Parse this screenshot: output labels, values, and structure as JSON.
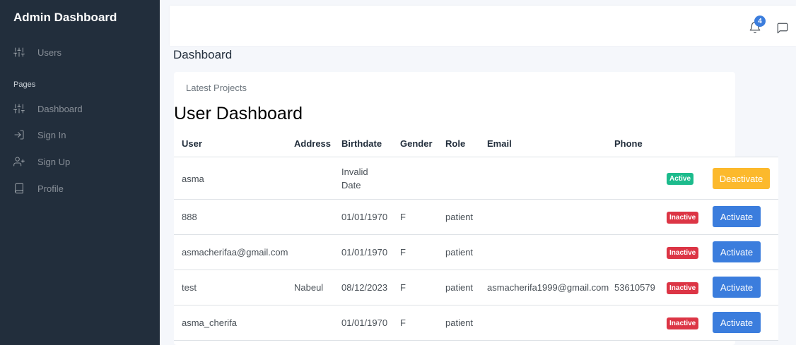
{
  "sidebar": {
    "brand": "Admin Dashboard",
    "items_top": [
      {
        "label": "Users",
        "icon": "sliders-icon"
      }
    ],
    "section_header": "Pages",
    "items": [
      {
        "label": "Dashboard",
        "icon": "sliders-icon"
      },
      {
        "label": "Sign In",
        "icon": "log-in-icon"
      },
      {
        "label": "Sign Up",
        "icon": "user-plus-icon"
      },
      {
        "label": "Profile",
        "icon": "book-icon"
      }
    ]
  },
  "topbar": {
    "notification_count": "4",
    "icons": [
      "bell-icon",
      "message-square-icon"
    ]
  },
  "page": {
    "title": "Dashboard"
  },
  "card": {
    "subtitle": "Latest Projects",
    "heading": "User Dashboard",
    "columns": [
      "User",
      "Address",
      "Birthdate",
      "Gender",
      "Role",
      "Email",
      "Phone"
    ],
    "rows": [
      {
        "user": "asma",
        "address": "",
        "birthdate": "Invalid Date",
        "gender": "",
        "role": "",
        "email": "",
        "phone": "",
        "status": "Active",
        "action": "Deactivate"
      },
      {
        "user": "888",
        "address": "",
        "birthdate": "01/01/1970",
        "gender": "F",
        "role": "patient",
        "email": "",
        "phone": "",
        "status": "Inactive",
        "action": "Activate"
      },
      {
        "user": "asmacherifaa@gmail.com",
        "address": "",
        "birthdate": "01/01/1970",
        "gender": "F",
        "role": "patient",
        "email": "",
        "phone": "",
        "status": "Inactive",
        "action": "Activate"
      },
      {
        "user": "test",
        "address": "Nabeul",
        "birthdate": "08/12/2023",
        "gender": "F",
        "role": "patient",
        "email": "asmacherifa1999@gmail.com",
        "phone": "53610579",
        "status": "Inactive",
        "action": "Activate"
      },
      {
        "user": "asma_cherifa",
        "address": "",
        "birthdate": "01/01/1970",
        "gender": "F",
        "role": "patient",
        "email": "",
        "phone": "",
        "status": "Inactive",
        "action": "Activate"
      }
    ]
  },
  "colors": {
    "sidebar_bg": "#222e3c",
    "primary": "#3b7ddd",
    "warning": "#fcb92c",
    "success": "#1cbb8c",
    "danger": "#dc3545"
  }
}
